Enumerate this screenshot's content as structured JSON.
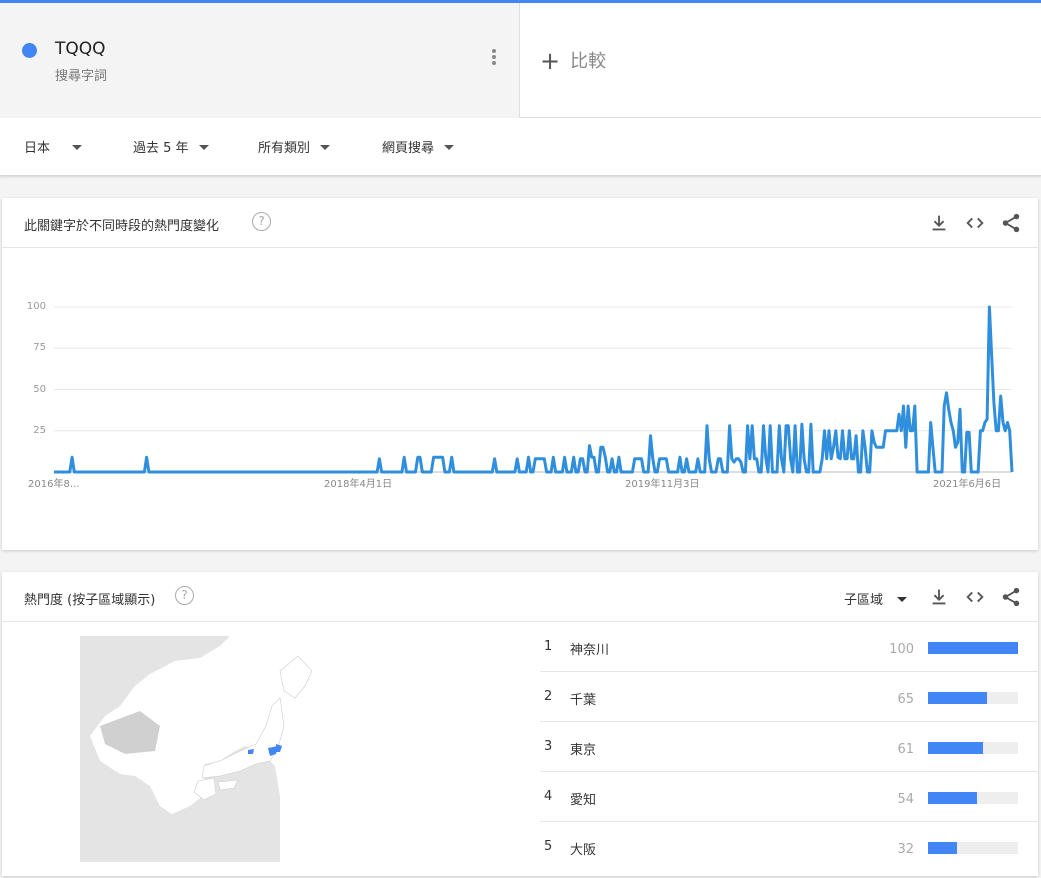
{
  "search_term": {
    "name": "TQQQ",
    "type": "搜尋字詞",
    "color": "#4285f4"
  },
  "compare": {
    "label": "比較",
    "icon": "plus-icon"
  },
  "filters": [
    {
      "label": "日本"
    },
    {
      "label": "過去 5 年"
    },
    {
      "label": "所有類別"
    },
    {
      "label": "網頁搜尋"
    }
  ],
  "timeline": {
    "title": "此關鍵字於不同時段的熱門度變化",
    "tools": [
      "download-icon",
      "embed-icon",
      "share-icon"
    ]
  },
  "chart_data": {
    "type": "line",
    "y_ticks": [
      100,
      75,
      50,
      25
    ],
    "ylim": [
      0,
      100
    ],
    "x_tick_labels": [
      "2016年8…",
      "2018年4月1日",
      "2019年11月3日",
      "2021年6月6日"
    ],
    "grid": true,
    "series": [
      {
        "color": "#2f8fdc",
        "values": [
          0,
          0,
          0,
          0,
          0,
          0,
          0,
          0,
          9,
          0,
          0,
          0,
          0,
          0,
          0,
          0,
          0,
          0,
          0,
          0,
          0,
          0,
          0,
          0,
          0,
          0,
          0,
          0,
          0,
          0,
          0,
          0,
          0,
          0,
          0,
          0,
          0,
          0,
          0,
          0,
          0,
          9,
          0,
          0,
          0,
          0,
          0,
          0,
          0,
          0,
          0,
          0,
          0,
          0,
          0,
          0,
          0,
          0,
          0,
          0,
          0,
          0,
          0,
          0,
          0,
          0,
          0,
          0,
          0,
          0,
          0,
          0,
          0,
          0,
          0,
          0,
          0,
          0,
          0,
          0,
          0,
          0,
          0,
          0,
          0,
          0,
          0,
          0,
          0,
          0,
          0,
          0,
          0,
          0,
          0,
          0,
          0,
          0,
          0,
          0,
          0,
          0,
          0,
          0,
          0,
          0,
          0,
          0,
          0,
          0,
          0,
          0,
          0,
          0,
          0,
          0,
          0,
          0,
          0,
          0,
          0,
          0,
          0,
          0,
          0,
          0,
          0,
          0,
          0,
          0,
          0,
          0,
          0,
          0,
          0,
          0,
          0,
          0,
          0,
          0,
          0,
          0,
          0,
          0,
          8,
          0,
          0,
          0,
          0,
          0,
          0,
          0,
          0,
          0,
          0,
          9,
          0,
          0,
          0,
          0,
          0,
          9,
          9,
          0,
          0,
          0,
          0,
          0,
          9,
          9,
          9,
          9,
          9,
          0,
          0,
          0,
          9,
          0,
          0,
          0,
          0,
          0,
          0,
          0,
          0,
          0,
          0,
          0,
          0,
          0,
          0,
          0,
          0,
          0,
          0,
          8,
          0,
          0,
          0,
          0,
          0,
          0,
          0,
          0,
          0,
          8,
          0,
          0,
          0,
          0,
          9,
          0,
          0,
          8,
          8,
          8,
          8,
          8,
          0,
          0,
          0,
          9,
          0,
          0,
          0,
          0,
          9,
          0,
          0,
          0,
          9,
          0,
          0,
          8,
          8,
          0,
          0,
          16,
          9,
          9,
          0,
          0,
          15,
          15,
          9,
          0,
          0,
          8,
          0,
          0,
          9,
          0,
          0,
          0,
          0,
          0,
          0,
          8,
          8,
          8,
          8,
          0,
          0,
          0,
          22,
          8,
          0,
          0,
          8,
          8,
          8,
          8,
          0,
          0,
          0,
          0,
          0,
          9,
          0,
          0,
          8,
          0,
          0,
          0,
          0,
          8,
          0,
          0,
          0,
          28,
          8,
          0,
          0,
          0,
          8,
          8,
          0,
          0,
          0,
          28,
          8,
          6,
          8,
          8,
          6,
          0,
          0,
          28,
          8,
          28,
          8,
          8,
          0,
          0,
          28,
          9,
          0,
          28,
          0,
          0,
          0,
          28,
          8,
          0,
          28,
          28,
          8,
          0,
          28,
          0,
          0,
          29,
          8,
          0,
          0,
          29,
          0,
          0,
          0,
          0,
          8,
          25,
          8,
          25,
          8,
          15,
          25,
          9,
          8,
          25,
          8,
          8,
          25,
          8,
          8,
          22,
          0,
          0,
          25,
          15,
          0,
          0,
          25,
          18,
          15,
          15,
          15,
          15,
          25,
          25,
          25,
          25,
          25,
          25,
          35,
          25,
          40,
          15,
          40,
          25,
          25,
          40,
          0,
          0,
          0,
          0,
          0,
          0,
          30,
          15,
          0,
          0,
          0,
          0,
          40,
          48,
          38,
          30,
          25,
          15,
          18,
          38,
          0,
          0,
          24,
          24,
          0,
          0,
          0,
          0,
          25,
          25,
          30,
          32,
          100,
          70,
          42,
          25,
          25,
          46,
          30,
          25,
          30,
          25,
          0
        ]
      }
    ]
  },
  "regions": {
    "title": "熱門度 (按子區域顯示)",
    "selector": "子區域",
    "items": [
      {
        "rank": "1",
        "name": "神奈川",
        "value": "100",
        "pct": 100
      },
      {
        "rank": "2",
        "name": "千葉",
        "value": "65",
        "pct": 65
      },
      {
        "rank": "3",
        "name": "東京",
        "value": "61",
        "pct": 61
      },
      {
        "rank": "4",
        "name": "愛知",
        "value": "54",
        "pct": 54
      },
      {
        "rank": "5",
        "name": "大阪",
        "value": "32",
        "pct": 32
      }
    ]
  }
}
